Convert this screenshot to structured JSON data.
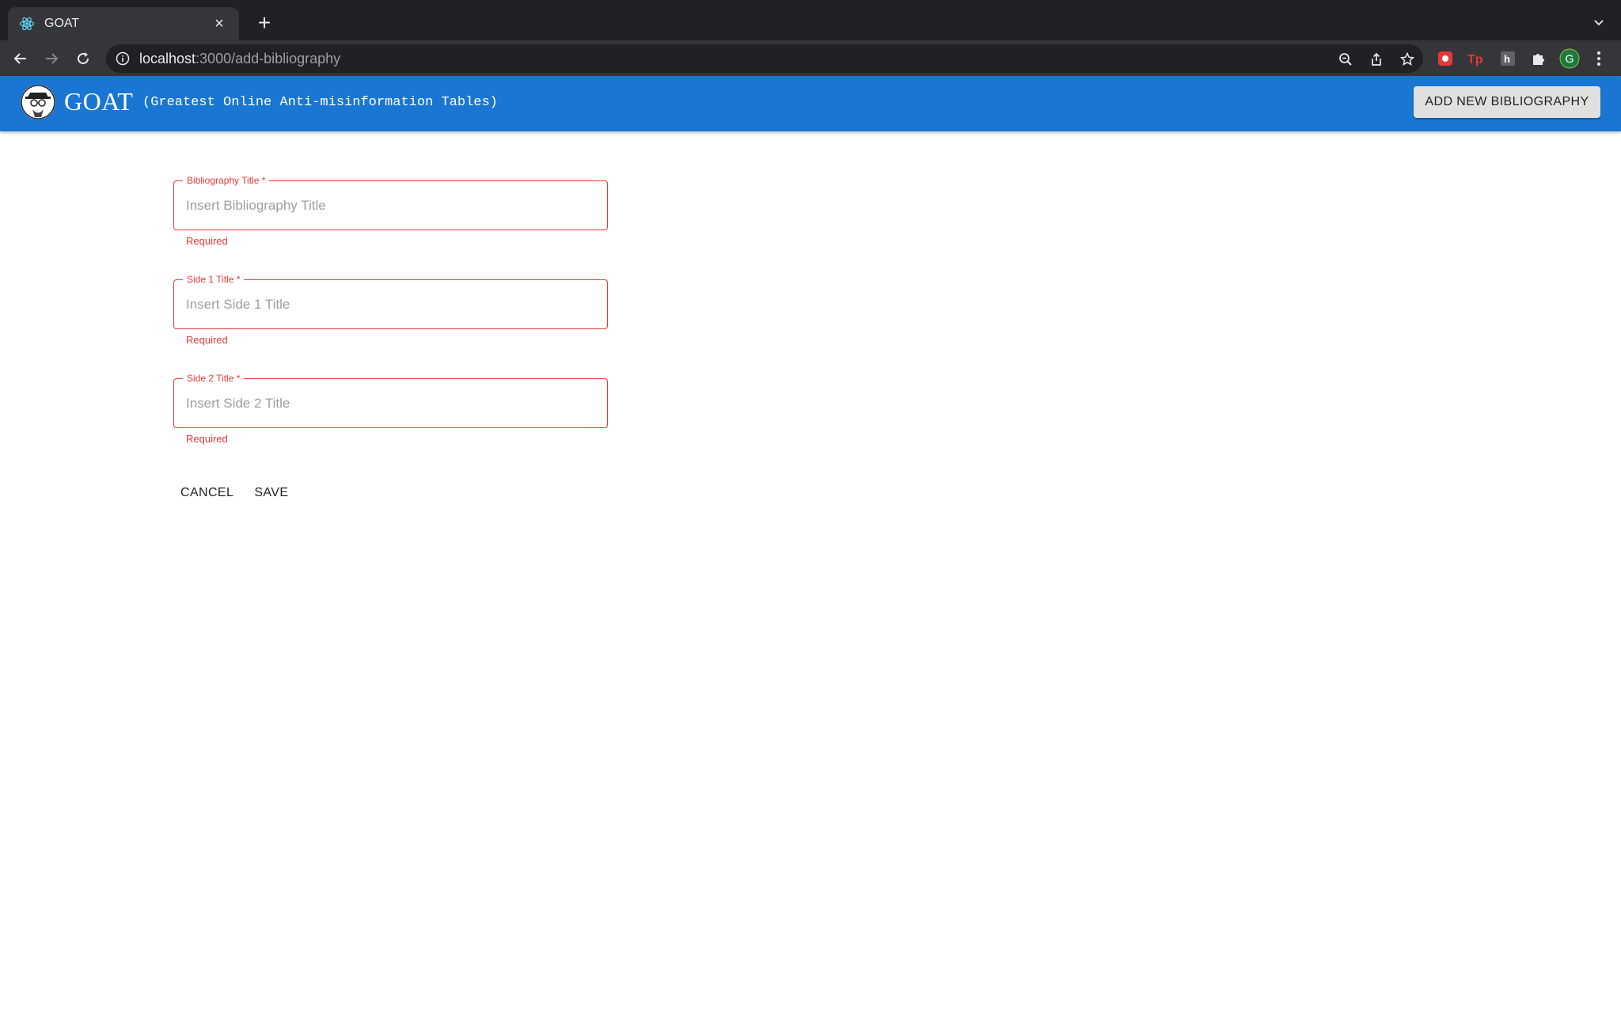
{
  "browser": {
    "tab_title": "GOAT",
    "new_tab_symbol": "+",
    "close_symbol": "×",
    "url_host": "localhost",
    "url_path": ":3000/add-bibliography",
    "profile_initial": "G"
  },
  "app": {
    "brand": "GOAT",
    "tagline": "(Greatest Online Anti-misinformation Tables)",
    "add_button": "ADD NEW BIBLIOGRAPHY",
    "primary_color": "#1976d2",
    "error_color": "#e53935"
  },
  "form": {
    "fields": [
      {
        "label": "Bibliography Title *",
        "placeholder": "Insert Bibliography Title",
        "helper": "Required"
      },
      {
        "label": "Side 1 Title *",
        "placeholder": "Insert Side 1 Title",
        "helper": "Required"
      },
      {
        "label": "Side 2 Title *",
        "placeholder": "Insert Side 2 Title",
        "helper": "Required"
      }
    ],
    "cancel_label": "CANCEL",
    "save_label": "SAVE"
  }
}
